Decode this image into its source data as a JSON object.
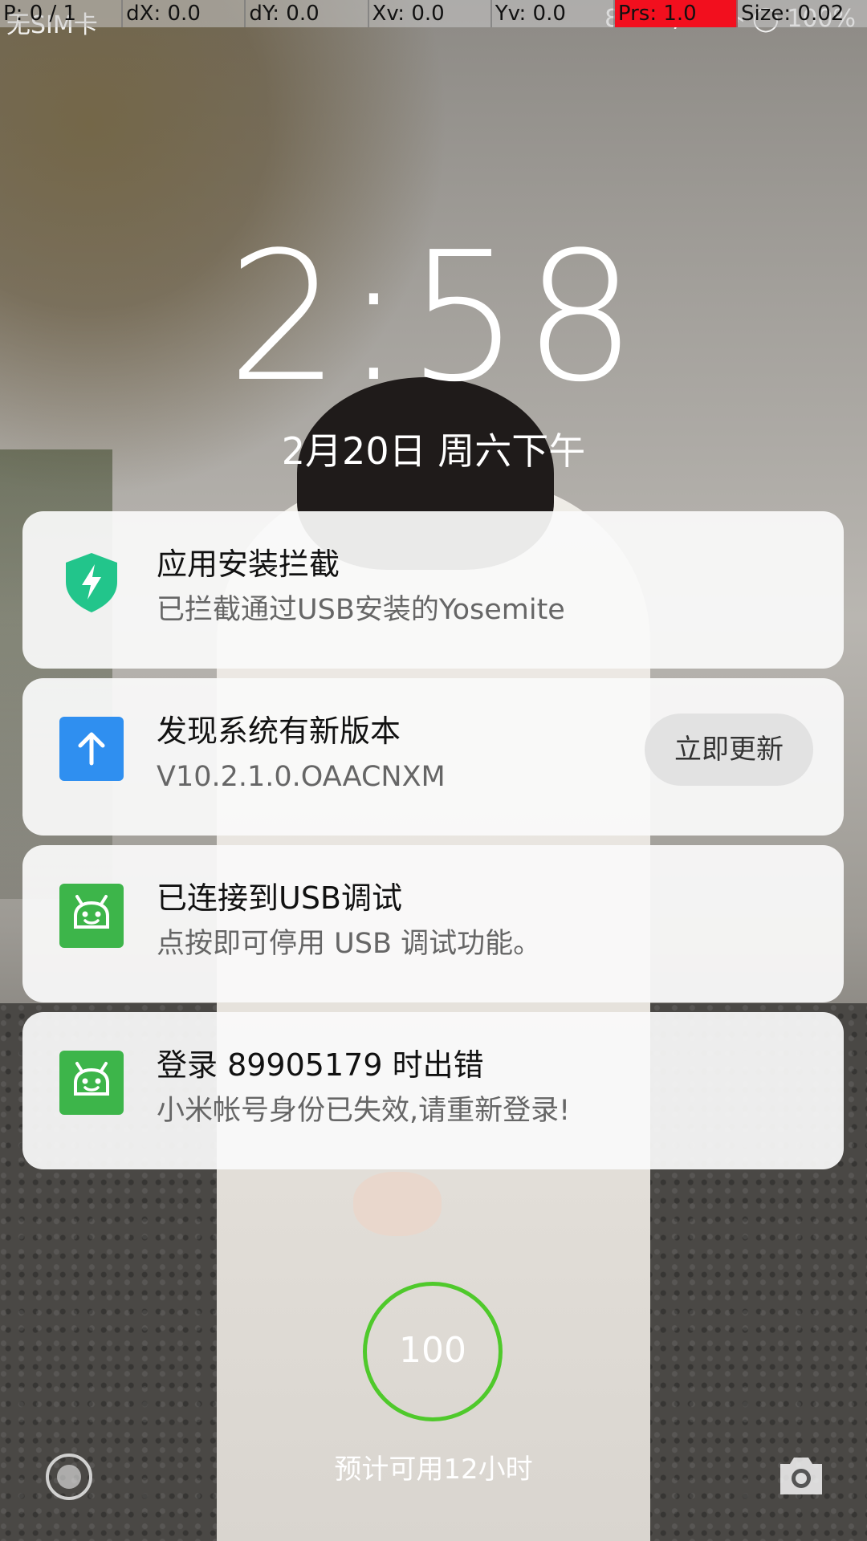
{
  "debug": {
    "p": "P: 0 / 1",
    "dx": "dX: 0.0",
    "dy": "dY: 0.0",
    "xv": "Xv: 0.0",
    "yv": "Yv: 0.0",
    "prs": "Prs: 1.0",
    "size": "Size: 0.02"
  },
  "status": {
    "carrier": "无SIM卡",
    "right": "8.34K/s  ⊡  ⌁  ◯  100%"
  },
  "lock": {
    "time": "2:58",
    "date": "2月20日  周六下午"
  },
  "notifications": [
    {
      "icon": "shield-icon",
      "title": "应用安装拦截",
      "body": "已拦截通过USB安装的Yosemite"
    },
    {
      "icon": "up-arrow-icon",
      "title": "发现系统有新版本",
      "body": "V10.2.1.0.OAACNXM",
      "action": "立即更新"
    },
    {
      "icon": "android-icon",
      "title": "已连接到USB调试",
      "body": "点按即可停用 USB 调试功能。"
    },
    {
      "icon": "android-icon",
      "title": "登录  89905179  时出错",
      "body": "小米帐号身份已失效,请重新登录!"
    }
  ],
  "battery": {
    "level": "100",
    "estimate": "预计可用12小时",
    "ring_color": "#4fc92b"
  }
}
